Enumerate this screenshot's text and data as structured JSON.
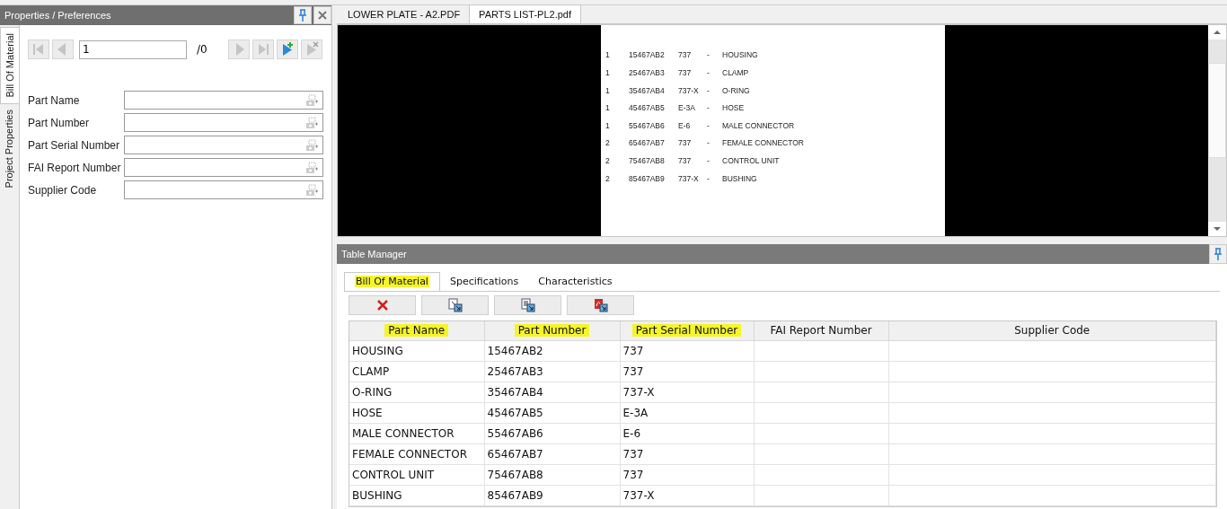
{
  "properties_panel": {
    "title": "Properties / Preferences",
    "side_tabs": [
      {
        "label": "Bill Of Material",
        "selected": true
      },
      {
        "label": "Project Properties",
        "selected": false
      }
    ],
    "navigator": {
      "value": "1",
      "total": "/0",
      "buttons": [
        {
          "kind": "first",
          "disabled": true
        },
        {
          "kind": "prev",
          "disabled": true
        },
        {
          "kind": "next",
          "disabled": true
        },
        {
          "kind": "last",
          "disabled": true
        },
        {
          "kind": "add",
          "disabled": false
        },
        {
          "kind": "remove",
          "disabled": true
        }
      ]
    },
    "fields": [
      {
        "label": "Part Name"
      },
      {
        "label": "Part Number"
      },
      {
        "label": "Part Serial Number"
      },
      {
        "label": "FAI Report Number"
      },
      {
        "label": "Supplier Code"
      }
    ]
  },
  "document_tabs": [
    {
      "label": "LOWER PLATE - A2.PDF",
      "selected": false
    },
    {
      "label": "PARTS LIST-PL2.pdf",
      "selected": true
    }
  ],
  "document_lines": [
    [
      "1",
      "15467AB2",
      "737",
      "-",
      "HOUSING"
    ],
    [
      "1",
      "25467AB3",
      "737",
      "-",
      "CLAMP"
    ],
    [
      "1",
      "35467AB4",
      "737-X",
      "-",
      "O-RING"
    ],
    [
      "1",
      "45467AB5",
      "E-3A",
      "-",
      "HOSE"
    ],
    [
      "1",
      "55467AB6",
      "E-6",
      "-",
      "MALE CONNECTOR"
    ],
    [
      "2",
      "65467AB7",
      "737",
      "-",
      "FEMALE CONNECTOR"
    ],
    [
      "2",
      "75467AB8",
      "737",
      "-",
      "CONTROL UNIT"
    ],
    [
      "2",
      "85467AB9",
      "737-X",
      "-",
      "BUSHING"
    ]
  ],
  "table_manager": {
    "title": "Table Manager",
    "tabs": [
      {
        "label": "Bill Of Material",
        "selected": true,
        "highlighted": true
      },
      {
        "label": "Specifications",
        "selected": false,
        "highlighted": false
      },
      {
        "label": "Characteristics",
        "selected": false,
        "highlighted": false
      }
    ],
    "toolbar": [
      {
        "kind": "delete"
      },
      {
        "kind": "import"
      },
      {
        "kind": "export"
      },
      {
        "kind": "pdf"
      }
    ],
    "columns": [
      {
        "label": "Part Name",
        "highlighted": true
      },
      {
        "label": "Part Number",
        "highlighted": true
      },
      {
        "label": "Part Serial Number",
        "highlighted": true
      },
      {
        "label": "FAI Report Number",
        "highlighted": false
      },
      {
        "label": "Supplier Code",
        "highlighted": false
      }
    ],
    "rows": [
      [
        "HOUSING",
        "15467AB2",
        "737"
      ],
      [
        "CLAMP",
        "25467AB3",
        "737"
      ],
      [
        "O-RING",
        "35467AB4",
        "737-X"
      ],
      [
        "HOSE",
        "45467AB5",
        "E-3A"
      ],
      [
        "MALE CONNECTOR",
        "55467AB6",
        "E-6"
      ],
      [
        "FEMALE CONNECTOR",
        "65467AB7",
        "737"
      ],
      [
        "CONTROL UNIT",
        "75467AB8",
        "737"
      ],
      [
        "BUSHING",
        "85467AB9",
        "737-X"
      ]
    ]
  }
}
